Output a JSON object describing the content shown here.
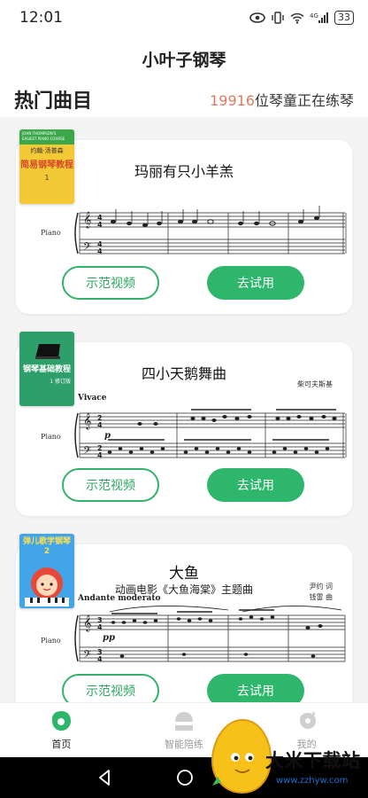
{
  "status": {
    "time": "12:01",
    "battery": "33",
    "net": "4G"
  },
  "app": {
    "title": "小叶子钢琴"
  },
  "section": {
    "title": "热门曲目",
    "count": "19916",
    "count_suffix": "位琴童正在练琴"
  },
  "songs": [
    {
      "title": "玛丽有只小羊羔",
      "instrument": "Piano",
      "cover_title_en": "JOHN THOMPSON'S EASIEST PIANO COURSE",
      "cover_author": "约翰·汤普森",
      "cover_title": "简易钢琴教程",
      "cover_number": "1",
      "demo_label": "示范视频",
      "try_label": "去试用"
    },
    {
      "title": "四小天鹅舞曲",
      "composer": "柴可夫斯基",
      "tempo": "Vivace",
      "instrument": "Piano",
      "cover_title": "钢琴基础教程",
      "cover_number": "1",
      "cover_edition": "修订版",
      "demo_label": "示范视频",
      "try_label": "去试用"
    },
    {
      "title": "大鱼",
      "subtitle": "动画电影《大鱼海棠》主题曲",
      "lyricist": "尹约 词",
      "composer": "钱雷 曲",
      "tempo": "Andante moderato",
      "instrument": "Piano",
      "cover_title": "弹儿歌学钢琴2",
      "demo_label": "示范视频",
      "try_label": "去试用"
    }
  ],
  "tabs": [
    {
      "label": "首页",
      "icon": "home-icon",
      "active": true
    },
    {
      "label": "智能陪练",
      "icon": "practice-icon",
      "active": false
    },
    {
      "label": "我的",
      "icon": "profile-icon",
      "active": false
    }
  ],
  "watermark": {
    "text": "大米下载站",
    "url": "www.zzhyw.com"
  },
  "colors": {
    "accent": "#2db66c",
    "count": "#e07a5f"
  }
}
